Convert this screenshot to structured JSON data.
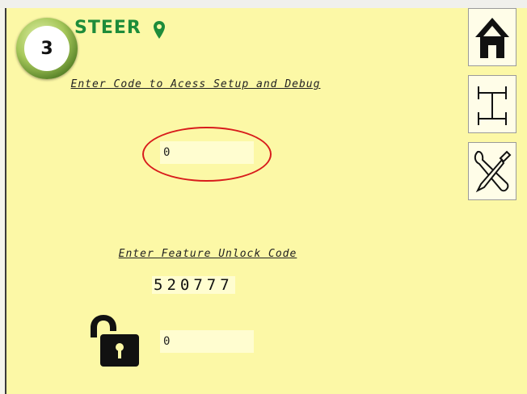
{
  "header": {
    "logo_text": "STEER",
    "step_number": "3"
  },
  "setup": {
    "label": "Enter Code to Acess Setup and Debug",
    "code_value": "0"
  },
  "feature_unlock": {
    "label": "Enter Feature Unlock Code",
    "displayed_code": "520777",
    "input_value": "0"
  },
  "sidebar": {
    "buttons": [
      {
        "icon": "home-icon"
      },
      {
        "icon": "chassis-icon"
      },
      {
        "icon": "tools-icon"
      }
    ]
  },
  "colors": {
    "screen_bg": "#fcf8a6",
    "field_bg": "#fffdd0",
    "highlight": "#d81c1c",
    "logo_green": "#1e8c3a"
  }
}
